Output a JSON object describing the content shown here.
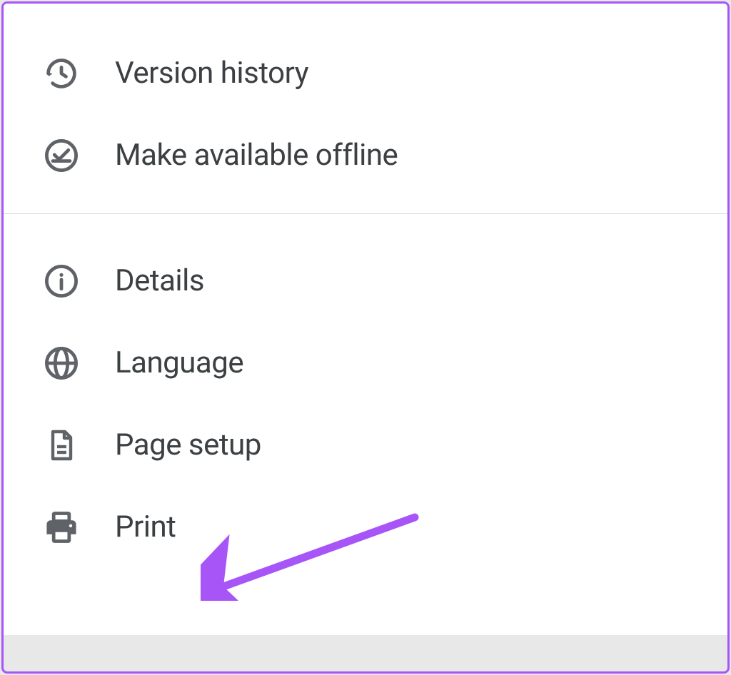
{
  "menu": {
    "group1": [
      {
        "id": "version-history",
        "label": "Version history",
        "icon": "history-icon"
      },
      {
        "id": "make-available-offline",
        "label": "Make available offline",
        "icon": "offline-icon"
      }
    ],
    "group2": [
      {
        "id": "details",
        "label": "Details",
        "icon": "info-icon"
      },
      {
        "id": "language",
        "label": "Language",
        "icon": "globe-icon"
      },
      {
        "id": "page-setup",
        "label": "Page setup",
        "icon": "page-icon"
      },
      {
        "id": "print",
        "label": "Print",
        "icon": "print-icon"
      }
    ]
  },
  "colors": {
    "iconStroke": "#5f6368",
    "text": "#3c4043",
    "accent": "#a855f7",
    "divider": "#dadce0"
  }
}
